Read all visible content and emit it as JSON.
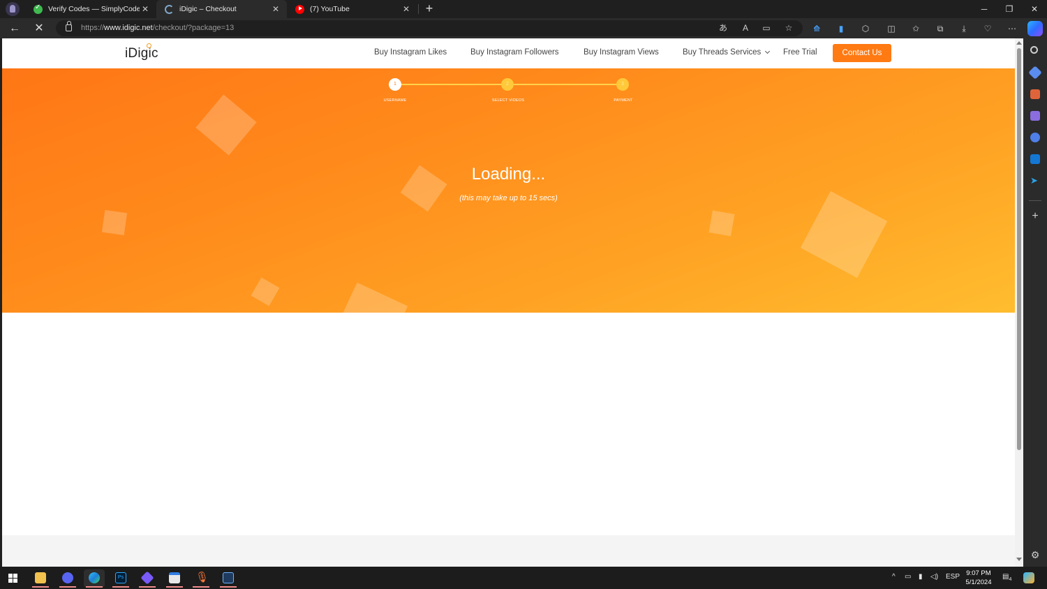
{
  "browser": {
    "tabs": [
      {
        "title": "Verify Codes — SimplyCodes",
        "favicon": "simplycodes-check-icon"
      },
      {
        "title": "iDigic – Checkout",
        "favicon": "loading-spinner-icon"
      },
      {
        "title": "(7) YouTube",
        "favicon": "youtube-icon"
      }
    ],
    "url_scheme": "https://",
    "url_host": "www.idigic.net",
    "url_path": "/checkout/?package=13"
  },
  "site": {
    "logo": "iDigic",
    "nav": [
      "Buy Instagram Likes",
      "Buy Instagram Followers",
      "Buy Instagram Views",
      "Buy Threads Services",
      "Free Trial"
    ],
    "contact_label": "Contact Us",
    "accent": "#ff7a13"
  },
  "checkout": {
    "steps": [
      {
        "number": "1",
        "label": "USERNAME"
      },
      {
        "number": "2",
        "label": "SELECT VIDEOS"
      },
      {
        "number": "3",
        "label": "PAYMENT"
      }
    ],
    "current_step": 1,
    "loading_title": "Loading...",
    "loading_subtitle": "(this may take up to 15 secs)"
  },
  "taskbar": {
    "language": "ESP",
    "time": "9:07 PM",
    "date": "5/1/2024",
    "notification_count": "4"
  }
}
